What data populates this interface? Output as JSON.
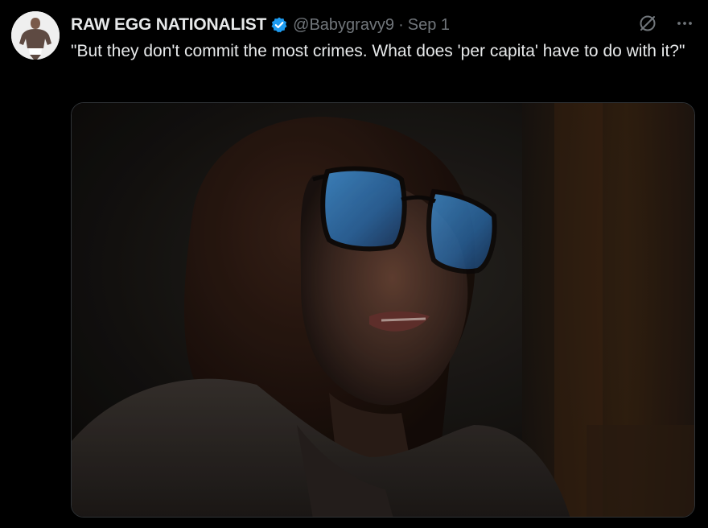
{
  "tweet": {
    "display_name": "RAW EGG NATIONALIST",
    "handle": "@Babygravy9",
    "separator": "·",
    "date": "Sep 1",
    "text": "\"But they don't commit the most crimes. What does 'per capita' have to do with it?\"",
    "verified": true
  },
  "icons": {
    "verified": "verified-badge-icon",
    "grok": "grok-icon",
    "more": "more-icon"
  },
  "colors": {
    "background": "#000000",
    "text_primary": "#e7e9ea",
    "text_secondary": "#71767b",
    "verified_blue": "#1d9bf0"
  }
}
